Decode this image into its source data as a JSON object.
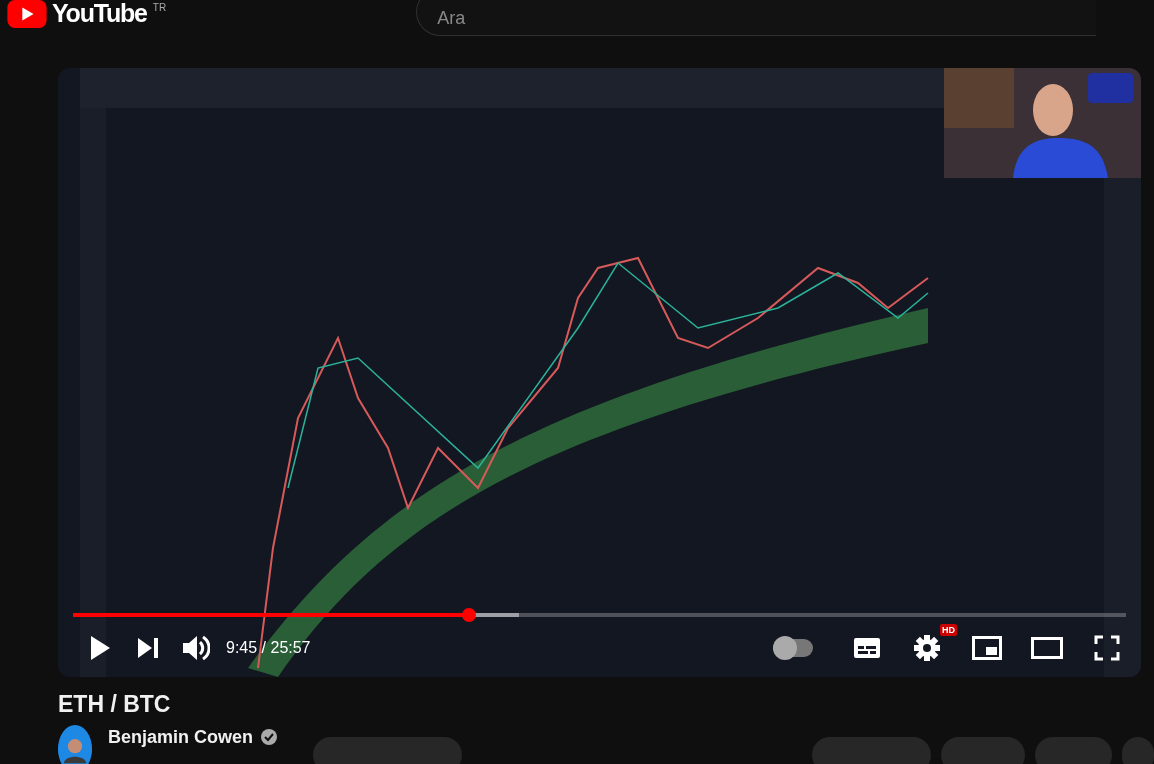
{
  "header": {
    "logo": "YouTube",
    "country": "TR",
    "search": {
      "placeholder": "Ara"
    }
  },
  "player": {
    "progress": {
      "level": 0.376
    },
    "buffer": {
      "level": 0.424
    },
    "time": "9:45 / 25:57",
    "autoplay": {
      "on": false
    },
    "settings": {
      "badge": "HD"
    }
  },
  "video": {
    "title": "ETH / BTC"
  },
  "channel": {
    "name": "Benjamin Cowen",
    "verified": true
  }
}
